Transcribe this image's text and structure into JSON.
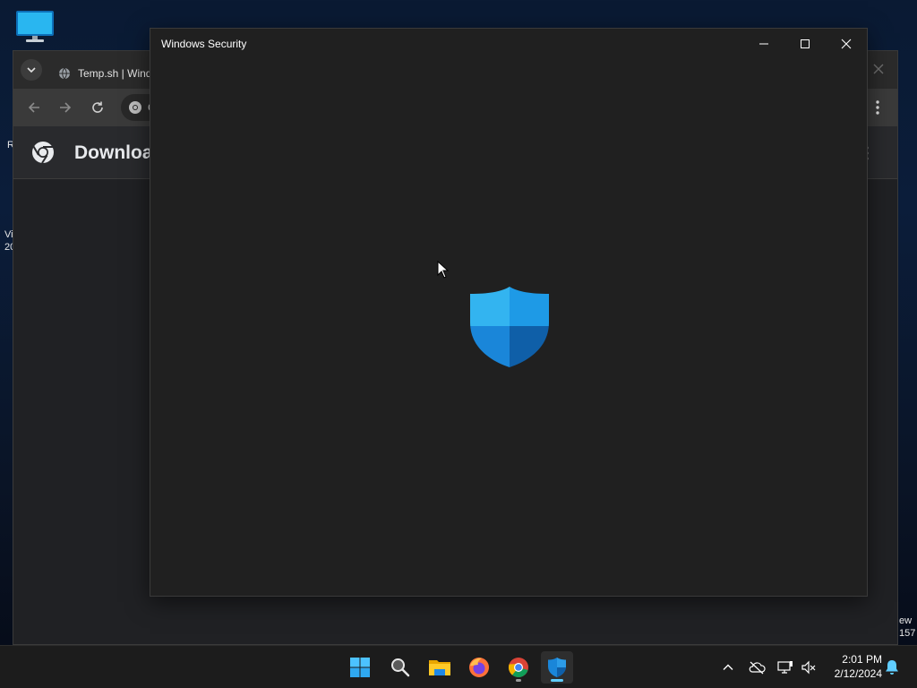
{
  "desktop": {
    "icons": [
      {
        "name": "This PC",
        "icon": "monitor-icon"
      }
    ],
    "left_edge_text": [
      "R",
      "Vi",
      "20"
    ],
    "right_edge_text": [
      "ew",
      "157"
    ]
  },
  "chrome": {
    "tab_title": "Temp.sh | Wind",
    "omnibox_text": "C",
    "page_title": "Downloa",
    "colors": {
      "frame": "#2b2b2b",
      "toolbar": "#3a3a3a",
      "content": "#202124"
    }
  },
  "security_window": {
    "title": "Windows Security",
    "shield_colors": {
      "light": "#33b4f0",
      "mid": "#1a86d9",
      "dark": "#0f5fa8"
    }
  },
  "taskbar": {
    "apps": [
      {
        "name": "Start",
        "icon": "windows-start-icon"
      },
      {
        "name": "Search",
        "icon": "search-icon"
      },
      {
        "name": "File Explorer",
        "icon": "folder-icon"
      },
      {
        "name": "Firefox",
        "icon": "firefox-icon"
      },
      {
        "name": "Google Chrome",
        "icon": "chrome-icon"
      },
      {
        "name": "Windows Security",
        "icon": "shield-icon"
      }
    ],
    "tray": [
      "chevron-up-icon",
      "onedrive-icon",
      "network-icon",
      "volume-muted-icon"
    ],
    "clock": {
      "time": "2:01 PM",
      "date": "2/12/2024"
    },
    "accent": "#60cdff"
  }
}
